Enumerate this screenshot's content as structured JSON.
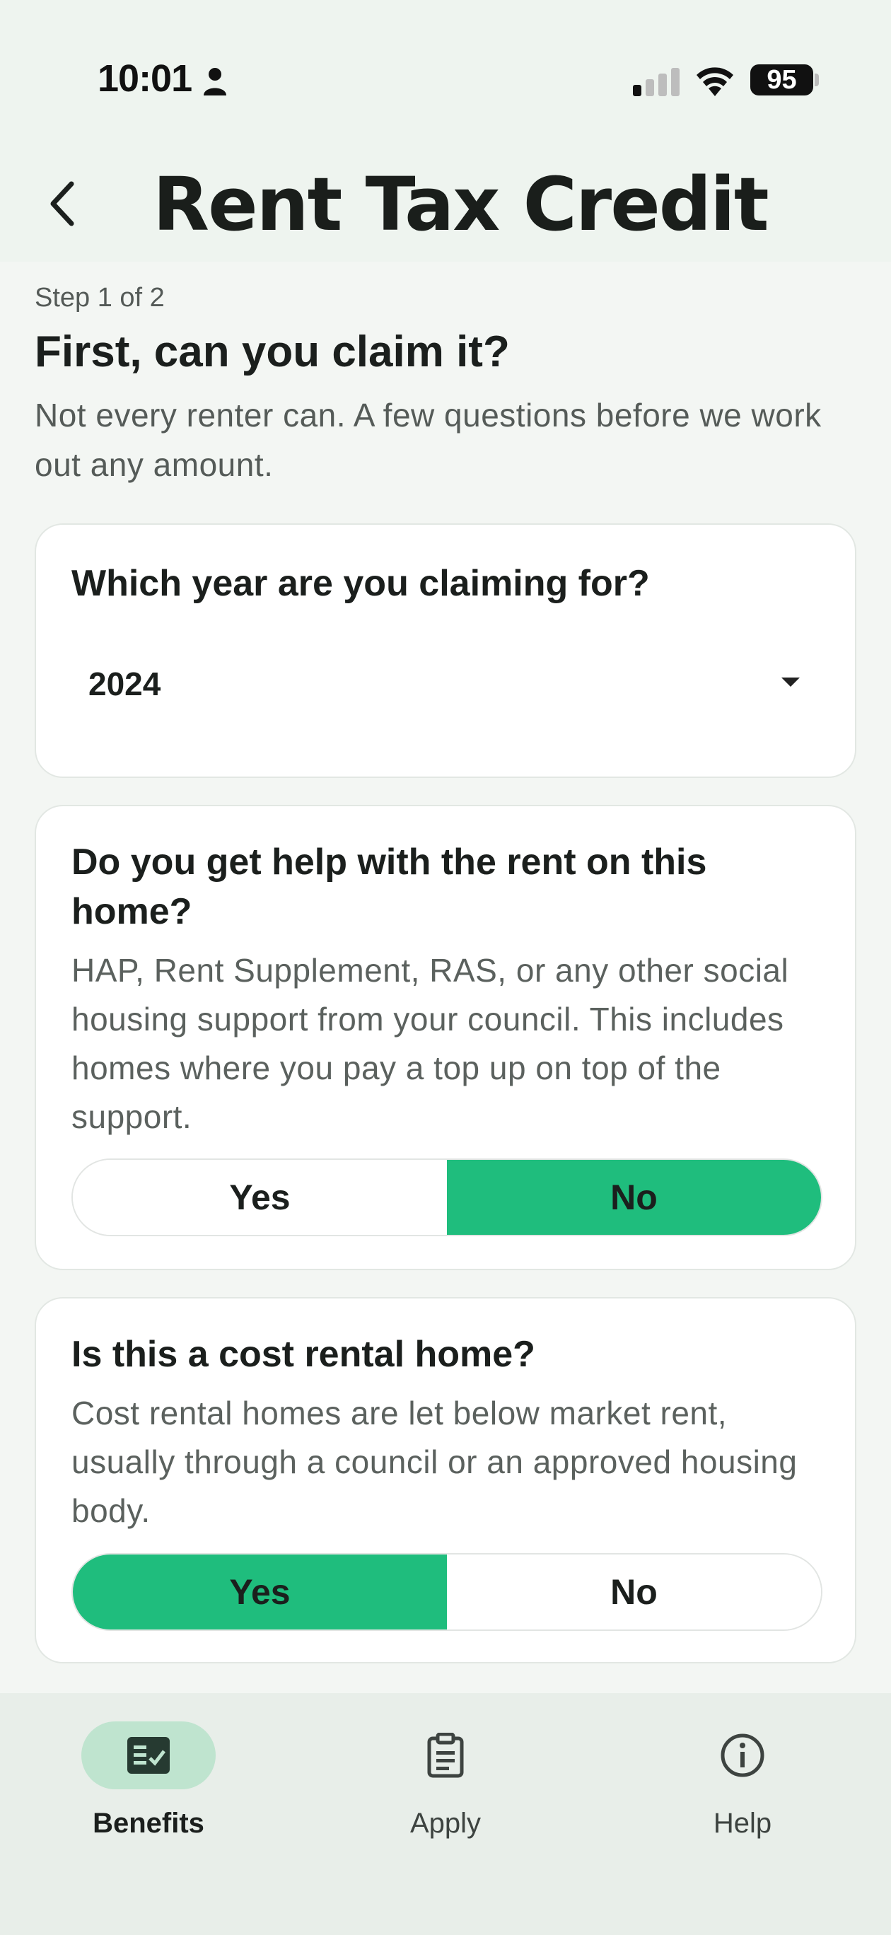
{
  "status_bar": {
    "time": "10:01",
    "battery": "95",
    "icons": [
      "person-icon",
      "cellular-signal-icon",
      "wifi-icon",
      "battery-icon"
    ]
  },
  "header": {
    "title": "Rent Tax Credit",
    "back_icon": "chevron-left-icon"
  },
  "intro": {
    "step": "Step 1 of 2",
    "title": "First, can you claim it?",
    "subtitle": "Not every renter can. A few questions before we work out any amount."
  },
  "questions": [
    {
      "question": "Which year are you claiming for?",
      "type": "select",
      "selected_value": "2024"
    },
    {
      "question": "Do you get help with the rent on this home?",
      "description": "HAP, Rent Supplement, RAS, or any other social housing support from your council. This includes homes where you pay a top up on top of the support.",
      "options": [
        "Yes",
        "No"
      ],
      "selected": "No"
    },
    {
      "question": "Is this a cost rental home?",
      "description": "Cost rental homes are let below market rent, usually through a council or an approved housing body.",
      "options": [
        "Yes",
        "No"
      ],
      "selected": "Yes"
    }
  ],
  "colors": {
    "accent": "#1fbd7d",
    "active_nav_pill": "#bfe4cf",
    "background": "#f3f6f3"
  },
  "bottom_nav": {
    "items": [
      {
        "label": "Benefits",
        "icon": "checklist-icon",
        "active": true
      },
      {
        "label": "Apply",
        "icon": "clipboard-icon",
        "active": false
      },
      {
        "label": "Help",
        "icon": "info-icon",
        "active": false
      }
    ]
  }
}
